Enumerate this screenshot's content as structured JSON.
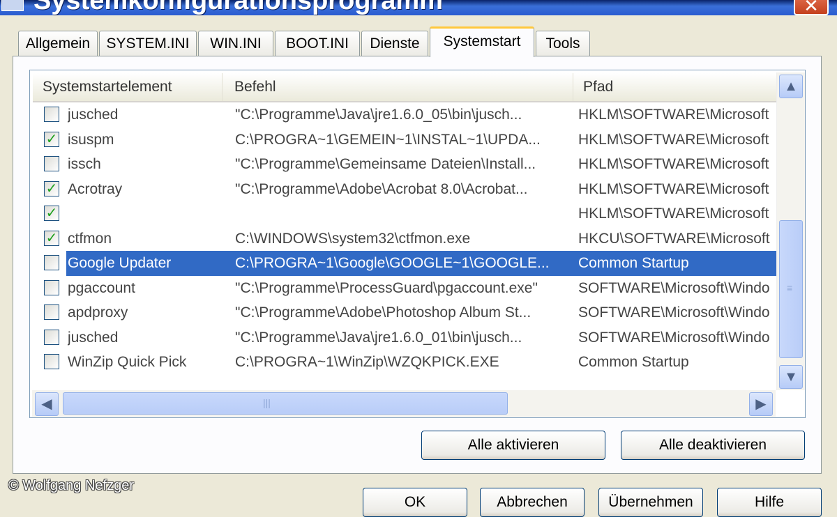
{
  "window": {
    "title": "Systemkonfigurationsprogramm"
  },
  "tabs": [
    {
      "label": "Allgemein"
    },
    {
      "label": "SYSTEM.INI"
    },
    {
      "label": "WIN.INI"
    },
    {
      "label": "BOOT.INI"
    },
    {
      "label": "Dienste"
    },
    {
      "label": "Systemstart",
      "active": true
    },
    {
      "label": "Tools"
    }
  ],
  "list": {
    "columns": [
      "Systemstartelement",
      "Befehl",
      "Pfad"
    ],
    "rows": [
      {
        "checked": false,
        "element": "jusched",
        "command": "\"C:\\Programme\\Java\\jre1.6.0_05\\bin\\jusch...",
        "path": "HKLM\\SOFTWARE\\Microsoft"
      },
      {
        "checked": true,
        "element": "isuspm",
        "command": "C:\\PROGRA~1\\GEMEIN~1\\INSTAL~1\\UPDA...",
        "path": "HKLM\\SOFTWARE\\Microsoft"
      },
      {
        "checked": false,
        "element": "issch",
        "command": "\"C:\\Programme\\Gemeinsame Dateien\\Install...",
        "path": "HKLM\\SOFTWARE\\Microsoft"
      },
      {
        "checked": true,
        "element": "Acrotray",
        "command": "\"C:\\Programme\\Adobe\\Acrobat 8.0\\Acrobat...",
        "path": "HKLM\\SOFTWARE\\Microsoft"
      },
      {
        "checked": true,
        "element": "",
        "command": "",
        "path": "HKLM\\SOFTWARE\\Microsoft"
      },
      {
        "checked": true,
        "element": "ctfmon",
        "command": "C:\\WINDOWS\\system32\\ctfmon.exe",
        "path": "HKCU\\SOFTWARE\\Microsoft"
      },
      {
        "checked": false,
        "selected": true,
        "element": "Google Updater",
        "command": "C:\\PROGRA~1\\Google\\GOOGLE~1\\GOOGLE...",
        "path": "Common Startup"
      },
      {
        "checked": false,
        "element": "pgaccount",
        "command": "\"C:\\Programme\\ProcessGuard\\pgaccount.exe\"",
        "path": "SOFTWARE\\Microsoft\\Windo"
      },
      {
        "checked": false,
        "element": "apdproxy",
        "command": "\"C:\\Programme\\Adobe\\Photoshop Album St...",
        "path": "SOFTWARE\\Microsoft\\Windo"
      },
      {
        "checked": false,
        "element": "jusched",
        "command": "\"C:\\Programme\\Java\\jre1.6.0_01\\bin\\jusch...",
        "path": "SOFTWARE\\Microsoft\\Windo"
      },
      {
        "checked": false,
        "element": "WinZip Quick Pick",
        "command": "C:\\PROGRA~1\\WinZip\\WZQKPICK.EXE",
        "path": "Common Startup"
      }
    ]
  },
  "buttons": {
    "enable_all": "Alle aktivieren",
    "disable_all": "Alle deaktivieren",
    "ok": "OK",
    "cancel": "Abbrechen",
    "apply": "Übernehmen",
    "help": "Hilfe"
  },
  "icons": {
    "check": "✓",
    "scroll_up": "▲",
    "scroll_down": "▼",
    "scroll_left": "◀",
    "scroll_right": "▶",
    "close": "✕"
  },
  "copyright": "© Wolfgang Nefzger",
  "colors": {
    "selection": "#316ac5",
    "check": "#21a121",
    "tab_accent": "#ffc83c"
  }
}
